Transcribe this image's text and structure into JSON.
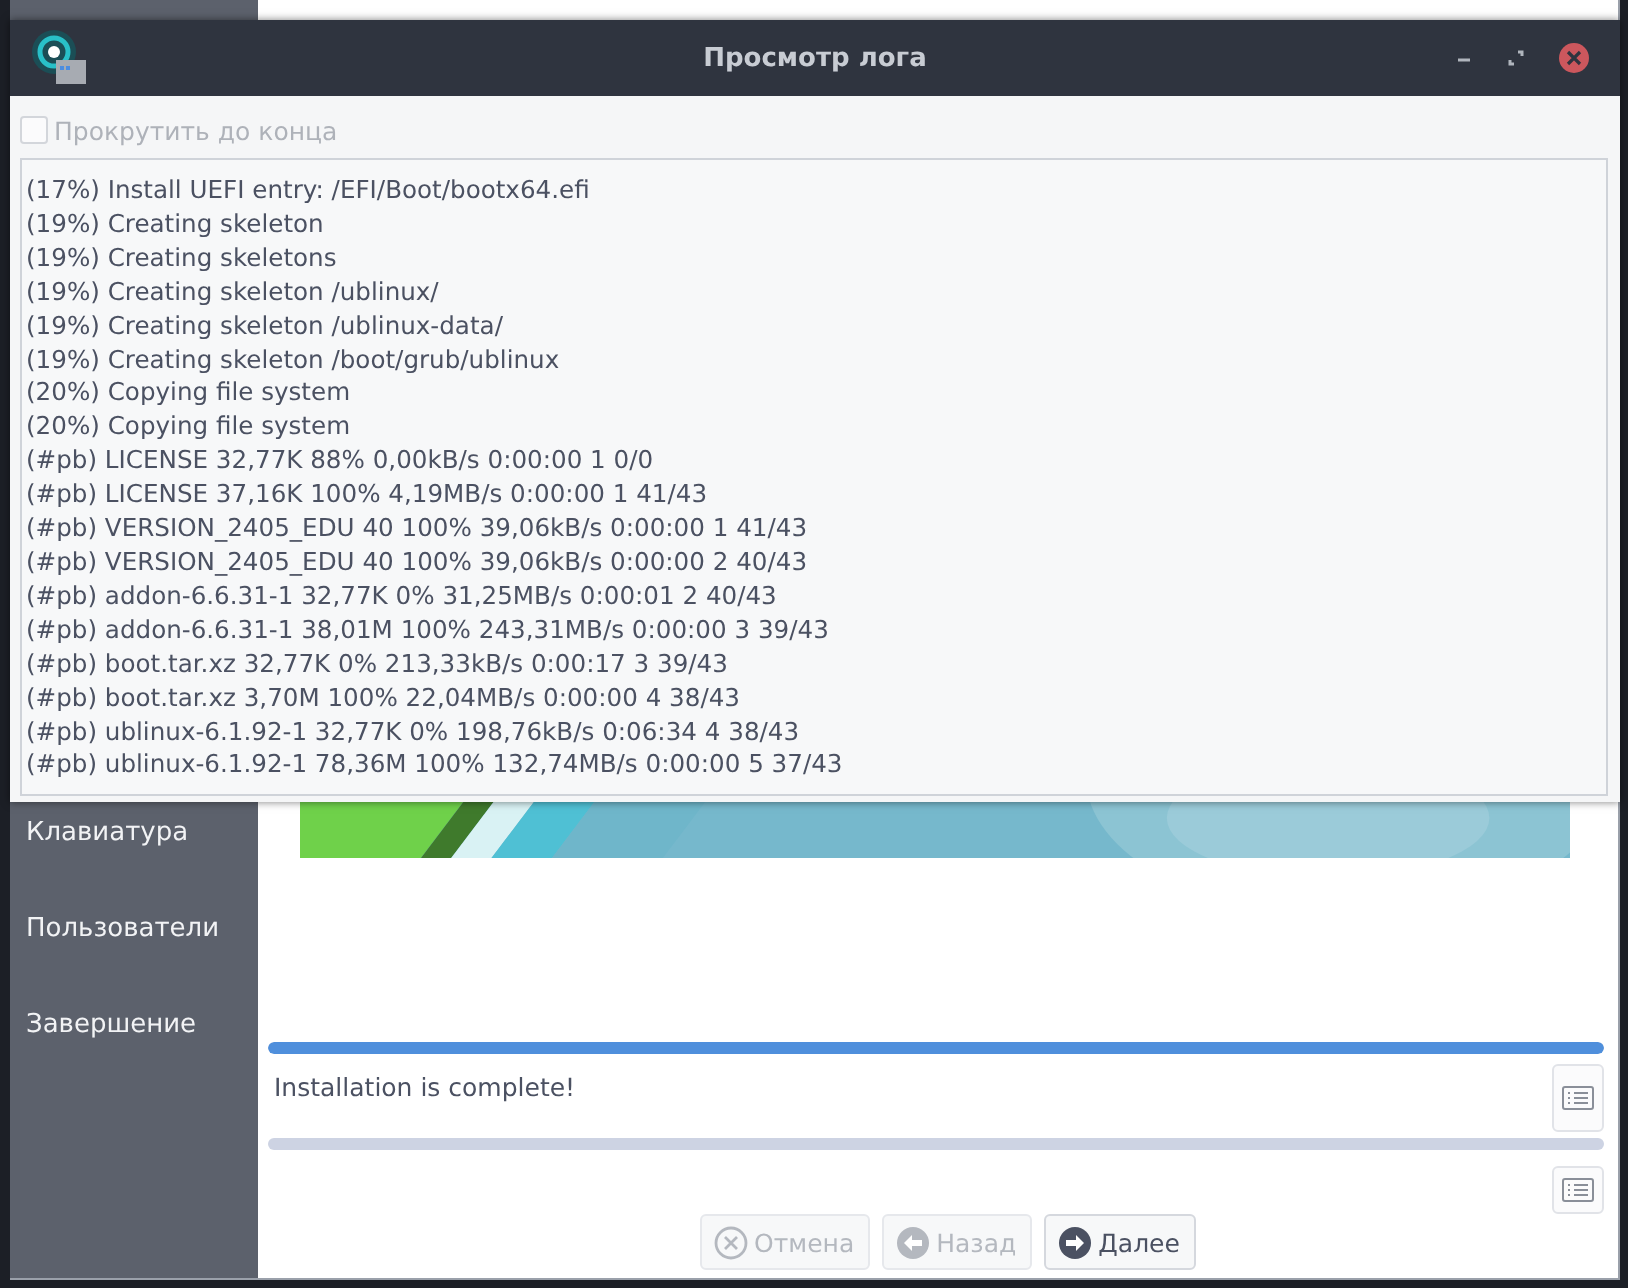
{
  "dialog": {
    "title": "Просмотр лога",
    "scroll_to_end": {
      "label": "Прокрутить до конца",
      "checked": false,
      "disabled": true
    },
    "log_lines": [
      "(17%) Install UEFI entry: /EFI/Boot/bootx64.efi",
      "(19%) Creating skeleton",
      "(19%) Creating skeletons",
      "(19%) Creating skeleton /ublinux/",
      "(19%) Creating skeleton /ublinux-data/",
      "(19%) Creating skeleton /boot/grub/ublinux",
      "(20%) Copying file system",
      "(20%) Copying file system",
      "(#pb) LICENSE 32,77K 88% 0,00kB/s 0:00:00 1 0/0",
      "(#pb) LICENSE 37,16K 100% 4,19MB/s 0:00:00 1 41/43",
      "(#pb) VERSION_2405_EDU 40 100% 39,06kB/s 0:00:00 1 41/43",
      "(#pb) VERSION_2405_EDU 40 100% 39,06kB/s 0:00:00 2 40/43",
      "(#pb) addon-6.6.31-1 32,77K 0% 31,25MB/s 0:00:01 2 40/43",
      "(#pb) addon-6.6.31-1 38,01M 100% 243,31MB/s 0:00:00 3 39/43",
      "(#pb) boot.tar.xz 32,77K 0% 213,33kB/s 0:00:17 3 39/43",
      "(#pb) boot.tar.xz 3,70M 100% 22,04MB/s 0:00:00 4 38/43",
      "(#pb) ublinux-6.1.92-1 32,77K 0% 198,76kB/s 0:06:34 4 38/43",
      "(#pb) ublinux-6.1.92-1 78,36M 100% 132,74MB/s 0:00:00 5 37/43"
    ]
  },
  "installer": {
    "sidebar": {
      "items": [
        "Клавиатура",
        "Пользователи",
        "Завершение"
      ]
    },
    "progress": {
      "level": 1
    },
    "status": "Installation is complete!",
    "buttons": [
      {
        "label": "Отмена",
        "disabled": true
      },
      {
        "label": "Назад",
        "disabled": true
      },
      {
        "label": "Далее",
        "disabled": false
      }
    ]
  }
}
